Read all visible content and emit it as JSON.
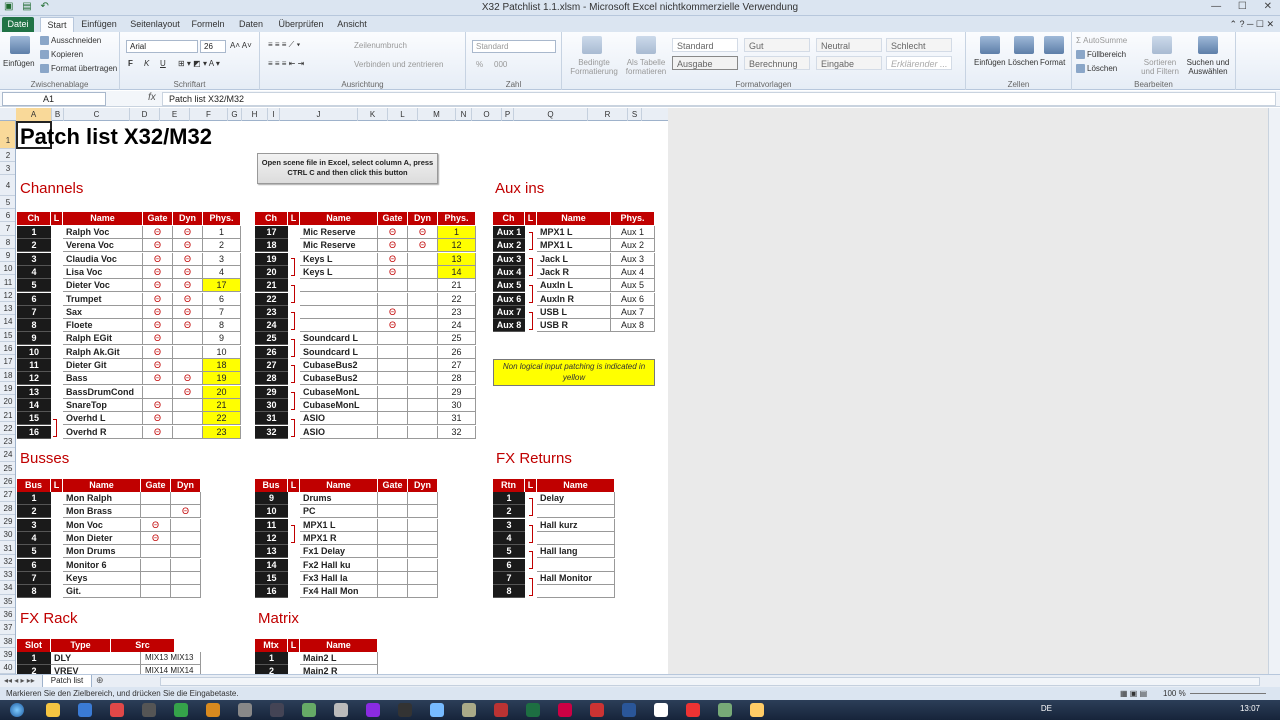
{
  "window": {
    "title": "X32 Patchlist 1.1.xlsm - Microsoft Excel nichtkommerzielle Verwendung"
  },
  "tabs": [
    "Datei",
    "Start",
    "Einfügen",
    "Seitenlayout",
    "Formeln",
    "Daten",
    "Überprüfen",
    "Ansicht"
  ],
  "ribbon": {
    "clipboard": {
      "paste": "Einfügen",
      "cut": "Ausschneiden",
      "copy": "Kopieren",
      "format_painter": "Format übertragen",
      "label": "Zwischenablage"
    },
    "font": {
      "name": "Arial",
      "size": "26",
      "label": "Schriftart",
      "bold": "F",
      "italic": "K",
      "underline": "U"
    },
    "alignment": {
      "wrap": "Zeilenumbruch",
      "merge": "Verbinden und zentrieren",
      "label": "Ausrichtung"
    },
    "number": {
      "format": "Standard",
      "label": "Zahl",
      "percent": "%",
      "thousands": "000"
    },
    "styles": {
      "conditional": "Bedingte Formatierung",
      "as_table": "Als Tabelle formatieren",
      "label": "Formatvorlagen",
      "cells": [
        "Standard",
        "Gut",
        "Neutral",
        "Schlecht",
        "Ausgabe",
        "Berechnung",
        "Eingabe",
        "Erklärender ..."
      ]
    },
    "cells": {
      "insert": "Einfügen",
      "delete": "Löschen",
      "format": "Format",
      "label": "Zellen"
    },
    "editing": {
      "autosum": "AutoSumme",
      "fill": "Füllbereich",
      "clear": "Löschen",
      "sort": "Sortieren und Filtern",
      "find": "Suchen und Auswählen",
      "label": "Bearbeiten"
    }
  },
  "formula_bar": {
    "name_box": "A1",
    "fx": "fx",
    "content": "Patch list X32/M32"
  },
  "columns": [
    "A",
    "B",
    "C",
    "D",
    "E",
    "F",
    "G",
    "H",
    "I",
    "J",
    "K",
    "L",
    "M",
    "N",
    "O",
    "P",
    "Q",
    "R",
    "S"
  ],
  "rows": [
    "1",
    "2",
    "3",
    "4",
    "5",
    "6",
    "7",
    "8",
    "9",
    "10",
    "11",
    "12",
    "13",
    "14",
    "15",
    "16",
    "17",
    "18",
    "19",
    "20",
    "21",
    "22",
    "23",
    "24",
    "25",
    "26",
    "27",
    "28",
    "29",
    "30",
    "31",
    "32",
    "33",
    "34",
    "35",
    "36",
    "37",
    "38",
    "39",
    "40"
  ],
  "sheet": {
    "title": "Patch list X32/M32",
    "button": "Open scene file in Excel, select column A, press CTRL C and then click this button",
    "note": "Non logical input patching is indicated in yellow",
    "theta": "Θ",
    "channels": {
      "section": "Channels",
      "headers": [
        "Ch",
        "L",
        "Name",
        "Gate",
        "Dyn",
        "Phys."
      ],
      "left": [
        {
          "ch": "1",
          "name": "Ralph Voc",
          "gate": "Θ",
          "dyn": "Θ",
          "phys": "1",
          "y": false
        },
        {
          "ch": "2",
          "name": "Verena Voc",
          "gate": "Θ",
          "dyn": "Θ",
          "phys": "2",
          "y": false
        },
        {
          "ch": "3",
          "name": "Claudia Voc",
          "gate": "Θ",
          "dyn": "Θ",
          "phys": "3",
          "y": false
        },
        {
          "ch": "4",
          "name": "Lisa Voc",
          "gate": "Θ",
          "dyn": "Θ",
          "phys": "4",
          "y": false
        },
        {
          "ch": "5",
          "name": "Dieter Voc",
          "gate": "Θ",
          "dyn": "Θ",
          "phys": "17",
          "y": true
        },
        {
          "ch": "6",
          "name": "Trumpet",
          "gate": "Θ",
          "dyn": "Θ",
          "phys": "6",
          "y": false
        },
        {
          "ch": "7",
          "name": "Sax",
          "gate": "Θ",
          "dyn": "Θ",
          "phys": "7",
          "y": false
        },
        {
          "ch": "8",
          "name": "Floete",
          "gate": "Θ",
          "dyn": "Θ",
          "phys": "8",
          "y": false
        },
        {
          "ch": "9",
          "name": "Ralph EGit",
          "gate": "Θ",
          "dyn": "",
          "phys": "9",
          "y": false
        },
        {
          "ch": "10",
          "name": "Ralph Ak.Git",
          "gate": "Θ",
          "dyn": "",
          "phys": "10",
          "y": false
        },
        {
          "ch": "11",
          "name": "Dieter Git",
          "gate": "Θ",
          "dyn": "",
          "phys": "18",
          "y": true
        },
        {
          "ch": "12",
          "name": "Bass",
          "gate": "Θ",
          "dyn": "Θ",
          "phys": "19",
          "y": true
        },
        {
          "ch": "13",
          "name": "BassDrumCond",
          "gate": "",
          "dyn": "Θ",
          "phys": "20",
          "y": true
        },
        {
          "ch": "14",
          "name": "SnareTop",
          "gate": "Θ",
          "dyn": "",
          "phys": "21",
          "y": true
        },
        {
          "ch": "15",
          "name": "Overhd L",
          "gate": "Θ",
          "dyn": "",
          "phys": "22",
          "y": true
        },
        {
          "ch": "16",
          "name": "Overhd R",
          "gate": "Θ",
          "dyn": "",
          "phys": "23",
          "y": true
        }
      ],
      "right": [
        {
          "ch": "17",
          "name": "Mic Reserve",
          "gate": "Θ",
          "dyn": "Θ",
          "phys": "1",
          "y": true
        },
        {
          "ch": "18",
          "name": "Mic Reserve",
          "gate": "Θ",
          "dyn": "Θ",
          "phys": "12",
          "y": true
        },
        {
          "ch": "19",
          "name": "Keys L",
          "gate": "Θ",
          "dyn": "",
          "phys": "13",
          "y": true
        },
        {
          "ch": "20",
          "name": "Keys L",
          "gate": "Θ",
          "dyn": "",
          "phys": "14",
          "y": true
        },
        {
          "ch": "21",
          "name": "",
          "gate": "",
          "dyn": "",
          "phys": "21",
          "y": false
        },
        {
          "ch": "22",
          "name": "",
          "gate": "",
          "dyn": "",
          "phys": "22",
          "y": false
        },
        {
          "ch": "23",
          "name": "",
          "gate": "Θ",
          "dyn": "",
          "phys": "23",
          "y": false
        },
        {
          "ch": "24",
          "name": "",
          "gate": "Θ",
          "dyn": "",
          "phys": "24",
          "y": false
        },
        {
          "ch": "25",
          "name": "Soundcard L",
          "gate": "",
          "dyn": "",
          "phys": "25",
          "y": false
        },
        {
          "ch": "26",
          "name": "Soundcard L",
          "gate": "",
          "dyn": "",
          "phys": "26",
          "y": false
        },
        {
          "ch": "27",
          "name": "CubaseBus2",
          "gate": "",
          "dyn": "",
          "phys": "27",
          "y": false
        },
        {
          "ch": "28",
          "name": "CubaseBus2",
          "gate": "",
          "dyn": "",
          "phys": "28",
          "y": false
        },
        {
          "ch": "29",
          "name": "CubaseMonL",
          "gate": "",
          "dyn": "",
          "phys": "29",
          "y": false
        },
        {
          "ch": "30",
          "name": "CubaseMonL",
          "gate": "",
          "dyn": "",
          "phys": "30",
          "y": false
        },
        {
          "ch": "31",
          "name": "ASIO",
          "gate": "",
          "dyn": "",
          "phys": "31",
          "y": false
        },
        {
          "ch": "32",
          "name": "ASIO",
          "gate": "",
          "dyn": "",
          "phys": "32",
          "y": false
        }
      ]
    },
    "aux": {
      "section": "Aux ins",
      "headers": [
        "Ch",
        "L",
        "Name",
        "Phys."
      ],
      "rows": [
        {
          "ch": "Aux 1",
          "name": "MPX1 L",
          "phys": "Aux 1"
        },
        {
          "ch": "Aux 2",
          "name": "MPX1 L",
          "phys": "Aux 2"
        },
        {
          "ch": "Aux 3",
          "name": "Jack L",
          "phys": "Aux 3"
        },
        {
          "ch": "Aux 4",
          "name": "Jack R",
          "phys": "Aux 4"
        },
        {
          "ch": "Aux 5",
          "name": "AuxIn L",
          "phys": "Aux 5"
        },
        {
          "ch": "Aux 6",
          "name": "AuxIn R",
          "phys": "Aux 6"
        },
        {
          "ch": "Aux 7",
          "name": "USB L",
          "phys": "Aux 7"
        },
        {
          "ch": "Aux 8",
          "name": "USB R",
          "phys": "Aux 8"
        }
      ]
    },
    "busses": {
      "section": "Busses",
      "headers": [
        "Bus",
        "L",
        "Name",
        "Gate",
        "Dyn"
      ],
      "left": [
        {
          "ch": "1",
          "name": "Mon Ralph",
          "gate": "",
          "dyn": ""
        },
        {
          "ch": "2",
          "name": "Mon Brass",
          "gate": "",
          "dyn": "Θ"
        },
        {
          "ch": "3",
          "name": "Mon Voc",
          "gate": "Θ",
          "dyn": ""
        },
        {
          "ch": "4",
          "name": "Mon Dieter",
          "gate": "Θ",
          "dyn": ""
        },
        {
          "ch": "5",
          "name": "Mon Drums",
          "gate": "",
          "dyn": ""
        },
        {
          "ch": "6",
          "name": "Monitor 6",
          "gate": "",
          "dyn": ""
        },
        {
          "ch": "7",
          "name": "Keys",
          "gate": "",
          "dyn": ""
        },
        {
          "ch": "8",
          "name": "Git.",
          "gate": "",
          "dyn": ""
        }
      ],
      "right": [
        {
          "ch": "9",
          "name": "Drums",
          "gate": "",
          "dyn": ""
        },
        {
          "ch": "10",
          "name": "PC",
          "gate": "",
          "dyn": ""
        },
        {
          "ch": "11",
          "name": "MPX1 L",
          "gate": "",
          "dyn": ""
        },
        {
          "ch": "12",
          "name": "MPX1 R",
          "gate": "",
          "dyn": ""
        },
        {
          "ch": "13",
          "name": "Fx1 Delay",
          "gate": "",
          "dyn": ""
        },
        {
          "ch": "14",
          "name": "Fx2 Hall ku",
          "gate": "",
          "dyn": ""
        },
        {
          "ch": "15",
          "name": "Fx3 Hall la",
          "gate": "",
          "dyn": ""
        },
        {
          "ch": "16",
          "name": "Fx4 Hall Mon",
          "gate": "",
          "dyn": ""
        }
      ]
    },
    "fx_returns": {
      "section": "FX Returns",
      "headers": [
        "Rtn",
        "L",
        "Name"
      ],
      "rows": [
        {
          "ch": "1",
          "name": "Delay"
        },
        {
          "ch": "2",
          "name": ""
        },
        {
          "ch": "3",
          "name": "Hall kurz"
        },
        {
          "ch": "4",
          "name": ""
        },
        {
          "ch": "5",
          "name": "Hall lang"
        },
        {
          "ch": "6",
          "name": ""
        },
        {
          "ch": "7",
          "name": "Hall Monitor"
        },
        {
          "ch": "8",
          "name": ""
        }
      ]
    },
    "fx_rack": {
      "section": "FX Rack",
      "headers": [
        "Slot",
        "Type",
        "Src"
      ],
      "rows": [
        {
          "ch": "1",
          "type": "DLY",
          "src": "MIX13 MIX13"
        },
        {
          "ch": "2",
          "type": "VREV",
          "src": "MIX14 MIX14"
        }
      ]
    },
    "matrix": {
      "section": "Matrix",
      "headers": [
        "Mtx",
        "L",
        "Name"
      ],
      "rows": [
        {
          "ch": "1",
          "name": "Main2 L"
        },
        {
          "ch": "2",
          "name": "Main2 R"
        }
      ]
    }
  },
  "sheet_tab": "Patch list",
  "status": {
    "message": "Markieren Sie den Zielbereich, und drücken Sie die Eingabetaste.",
    "zoom": "100 %"
  },
  "taskbar": {
    "lang": "DE",
    "time": "13:07"
  }
}
